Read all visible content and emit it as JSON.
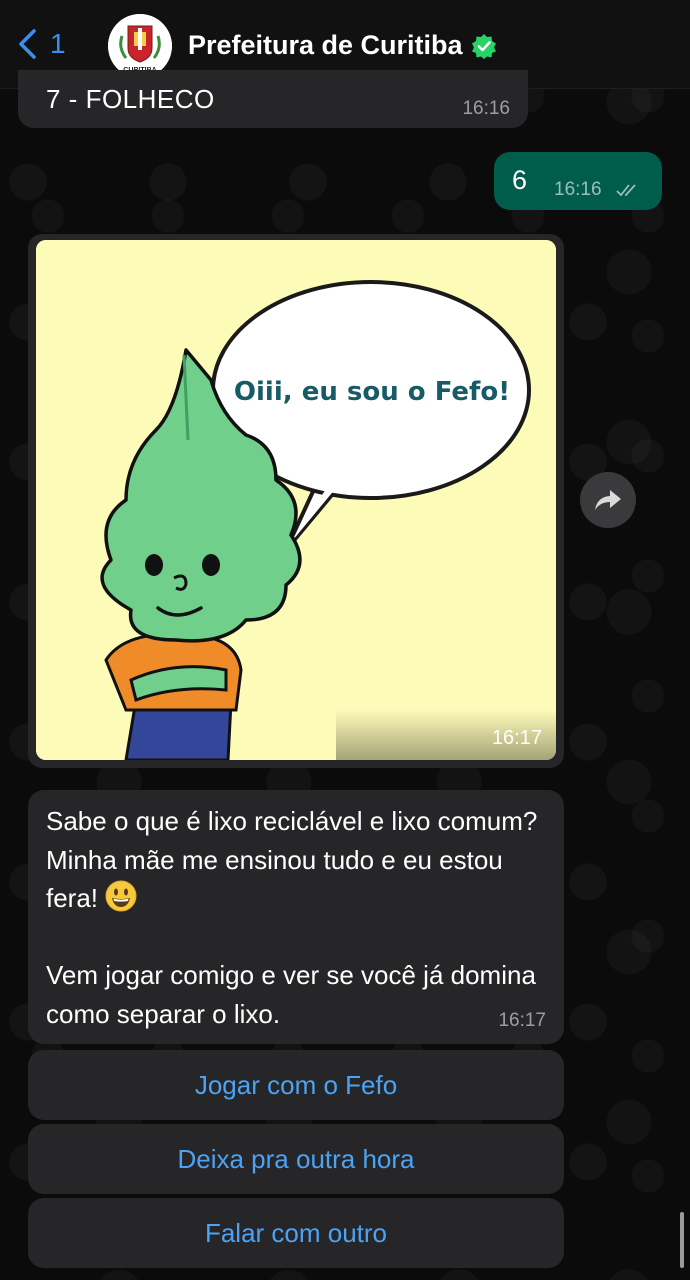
{
  "header": {
    "back_count": "1",
    "contact_name": "Prefeitura de Curitiba",
    "avatar_text": "CURITIBA",
    "verified_icon": "verified-badge-icon"
  },
  "messages": {
    "previous": {
      "text": "7 - FOLHECO",
      "time": "16:16"
    },
    "outgoing": {
      "text": "6",
      "time": "16:16",
      "status": "read"
    },
    "image": {
      "speech_text": "Oiii, eu sou o Fefo!",
      "time": "16:17",
      "colors": {
        "background": "#fdfbb8",
        "speech_text": "#185a66",
        "leaf": "#6fcf8b"
      }
    },
    "text": {
      "line1": "Sabe o que é lixo reciclável e lixo comum? Minha mãe me ensinou tudo e eu estou fera!",
      "line2": "Vem jogar comigo e ver se você já domina como separar o lixo.",
      "time": "16:17"
    }
  },
  "quick_replies": [
    {
      "label": "Jogar com o Fefo"
    },
    {
      "label": "Deixa pra outra hora"
    },
    {
      "label": "Falar com outro"
    }
  ],
  "colors": {
    "accent": "#3b8ff0",
    "incoming_bubble": "#262628",
    "outgoing_bubble": "#005c4b"
  }
}
